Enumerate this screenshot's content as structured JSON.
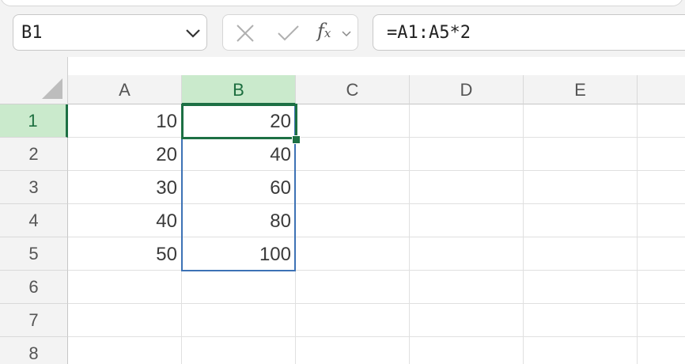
{
  "name_box": {
    "value": "B1"
  },
  "formula_bar": {
    "value": "=A1:A5*2",
    "fx_label": "fx"
  },
  "columns": [
    {
      "label": "A",
      "selected": false
    },
    {
      "label": "B",
      "selected": true
    },
    {
      "label": "C",
      "selected": false
    },
    {
      "label": "D",
      "selected": false
    },
    {
      "label": "E",
      "selected": false
    }
  ],
  "rows": [
    {
      "label": "1",
      "selected": true
    },
    {
      "label": "2",
      "selected": false
    },
    {
      "label": "3",
      "selected": false
    },
    {
      "label": "4",
      "selected": false
    },
    {
      "label": "5",
      "selected": false
    },
    {
      "label": "6",
      "selected": false
    },
    {
      "label": "7",
      "selected": false
    },
    {
      "label": "8",
      "selected": false
    }
  ],
  "cells": {
    "A": [
      "10",
      "20",
      "30",
      "40",
      "50"
    ],
    "B": [
      "20",
      "40",
      "60",
      "80",
      "100"
    ]
  },
  "colors": {
    "selection_green": "#1d7044",
    "header_highlight": "#caeacc",
    "spill_border": "#3d72b5"
  }
}
